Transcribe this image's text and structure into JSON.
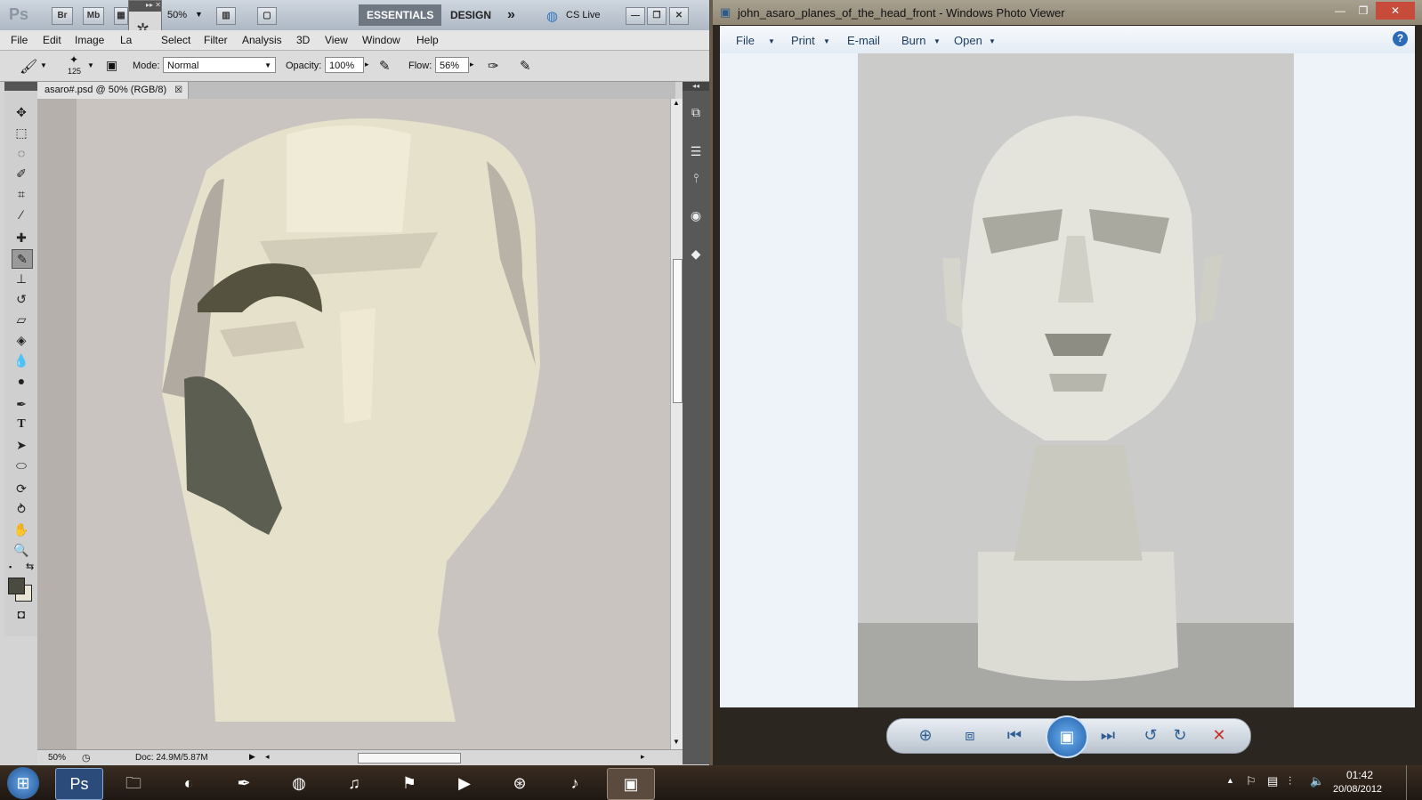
{
  "photoshop": {
    "app_buttons": {
      "logo": "Ps",
      "bridge": "Br",
      "mini_bridge": "Mb",
      "zoom": "50%"
    },
    "workspaces": {
      "essentials": "ESSENTIALS",
      "design": "DESIGN",
      "more": "»",
      "cs_live": "CS Live"
    },
    "menu": [
      "File",
      "Edit",
      "Image",
      "La",
      "Select",
      "Filter",
      "Analysis",
      "3D",
      "View",
      "Window",
      "Help"
    ],
    "options": {
      "brush_size": "125",
      "mode_label": "Mode:",
      "mode_value": "Normal",
      "opacity_label": "Opacity:",
      "opacity_value": "100%",
      "flow_label": "Flow:",
      "flow_value": "56%"
    },
    "document_tab": "asaro#.psd @ 50% (RGB/8)",
    "status": {
      "zoom": "50%",
      "doc": "Doc: 24.9M/5.87M"
    },
    "foreground_color": "#4a4a40",
    "background_color": "#e9e4d6"
  },
  "photo_viewer": {
    "title": "john_asaro_planes_of_the_head_front - Windows Photo Viewer",
    "menu": [
      "File",
      "Print",
      "E-mail",
      "Burn",
      "Open"
    ],
    "help": "?"
  },
  "taskbar": {
    "time": "01:42",
    "date": "20/08/2012"
  }
}
